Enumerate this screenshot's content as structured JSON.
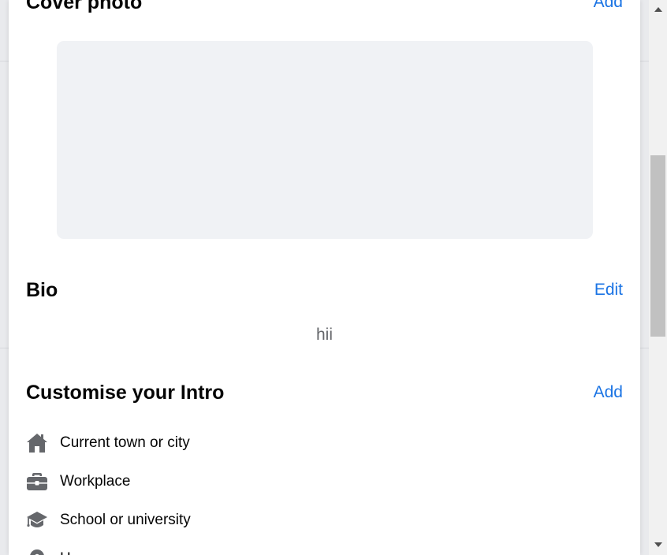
{
  "cover_photo": {
    "title": "Cover photo",
    "action": "Add"
  },
  "bio": {
    "title": "Bio",
    "action": "Edit",
    "text": "hii"
  },
  "intro": {
    "title": "Customise your Intro",
    "action": "Add",
    "items": [
      {
        "label": "Current town or city",
        "icon": "home-icon"
      },
      {
        "label": "Workplace",
        "icon": "briefcase-icon"
      },
      {
        "label": "School or university",
        "icon": "graduation-cap-icon"
      },
      {
        "label": "H",
        "icon": "location-pin-icon"
      }
    ]
  },
  "colors": {
    "accent": "#1b74e4",
    "icon": "#65676b",
    "placeholder": "#f0f2f5"
  }
}
